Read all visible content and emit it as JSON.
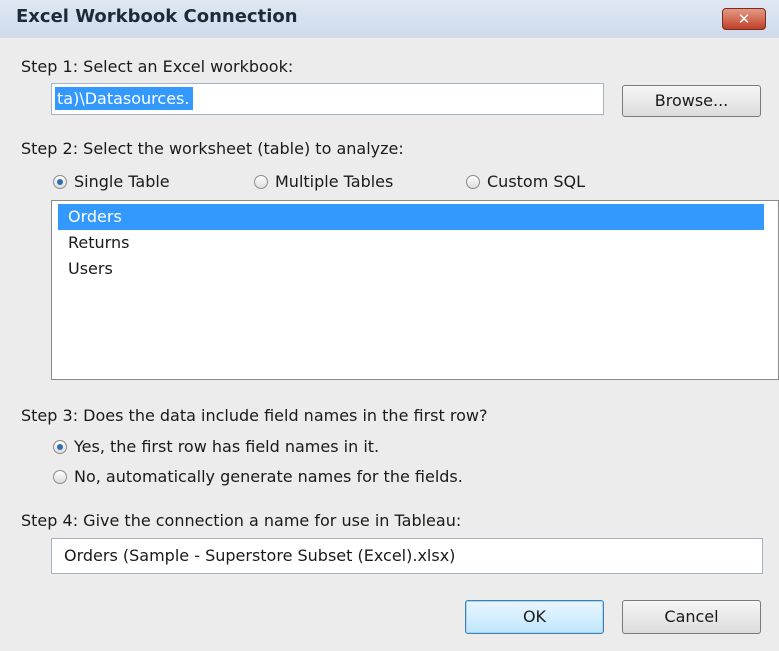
{
  "window": {
    "title": "Excel Workbook Connection",
    "close_label": "✕"
  },
  "step1": {
    "label": "Step 1: Select an Excel workbook:",
    "path_value": "ta)\\Datasources.",
    "browse_label": "Browse..."
  },
  "step2": {
    "label": "Step 2: Select the worksheet (table) to analyze:",
    "options": [
      {
        "label": "Single Table",
        "selected": true
      },
      {
        "label": "Multiple Tables",
        "selected": false
      },
      {
        "label": "Custom SQL",
        "selected": false
      }
    ],
    "tables": [
      {
        "name": "Orders",
        "selected": true
      },
      {
        "name": "Returns",
        "selected": false
      },
      {
        "name": "Users",
        "selected": false
      }
    ]
  },
  "step3": {
    "label": "Step 3: Does the data include field names in the first row?",
    "options": [
      {
        "label": "Yes, the first row has field names in it.",
        "selected": true
      },
      {
        "label": "No, automatically generate names for the fields.",
        "selected": false
      }
    ]
  },
  "step4": {
    "label": "Step 4: Give the connection a name for use in Tableau:",
    "name_value": "Orders (Sample - Superstore Subset (Excel).xlsx)"
  },
  "buttons": {
    "ok": "OK",
    "cancel": "Cancel"
  },
  "colors": {
    "selection": "#3399ff",
    "dialog_bg": "#ececec",
    "close_red": "#c0402a"
  }
}
